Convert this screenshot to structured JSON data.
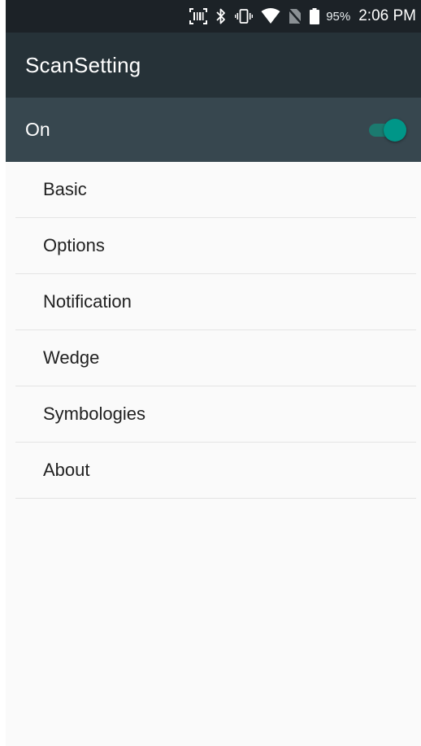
{
  "status_bar": {
    "battery_percent": "95%",
    "time": "2:06 PM",
    "icons": [
      "barcode-scanner-icon",
      "bluetooth-icon",
      "vibrate-icon",
      "wifi-icon",
      "no-sim-icon",
      "battery-icon"
    ]
  },
  "app_bar": {
    "title": "ScanSetting"
  },
  "master_switch": {
    "label": "On",
    "state": true,
    "accent_color": "#009688"
  },
  "menu": {
    "items": [
      {
        "label": "Basic"
      },
      {
        "label": "Options"
      },
      {
        "label": "Notification"
      },
      {
        "label": "Wedge"
      },
      {
        "label": "Symbologies"
      },
      {
        "label": "About"
      }
    ]
  },
  "colors": {
    "status_bar": "#1c2227",
    "app_bar": "#263238",
    "switch_bar": "#37474f",
    "background": "#fafafa"
  }
}
